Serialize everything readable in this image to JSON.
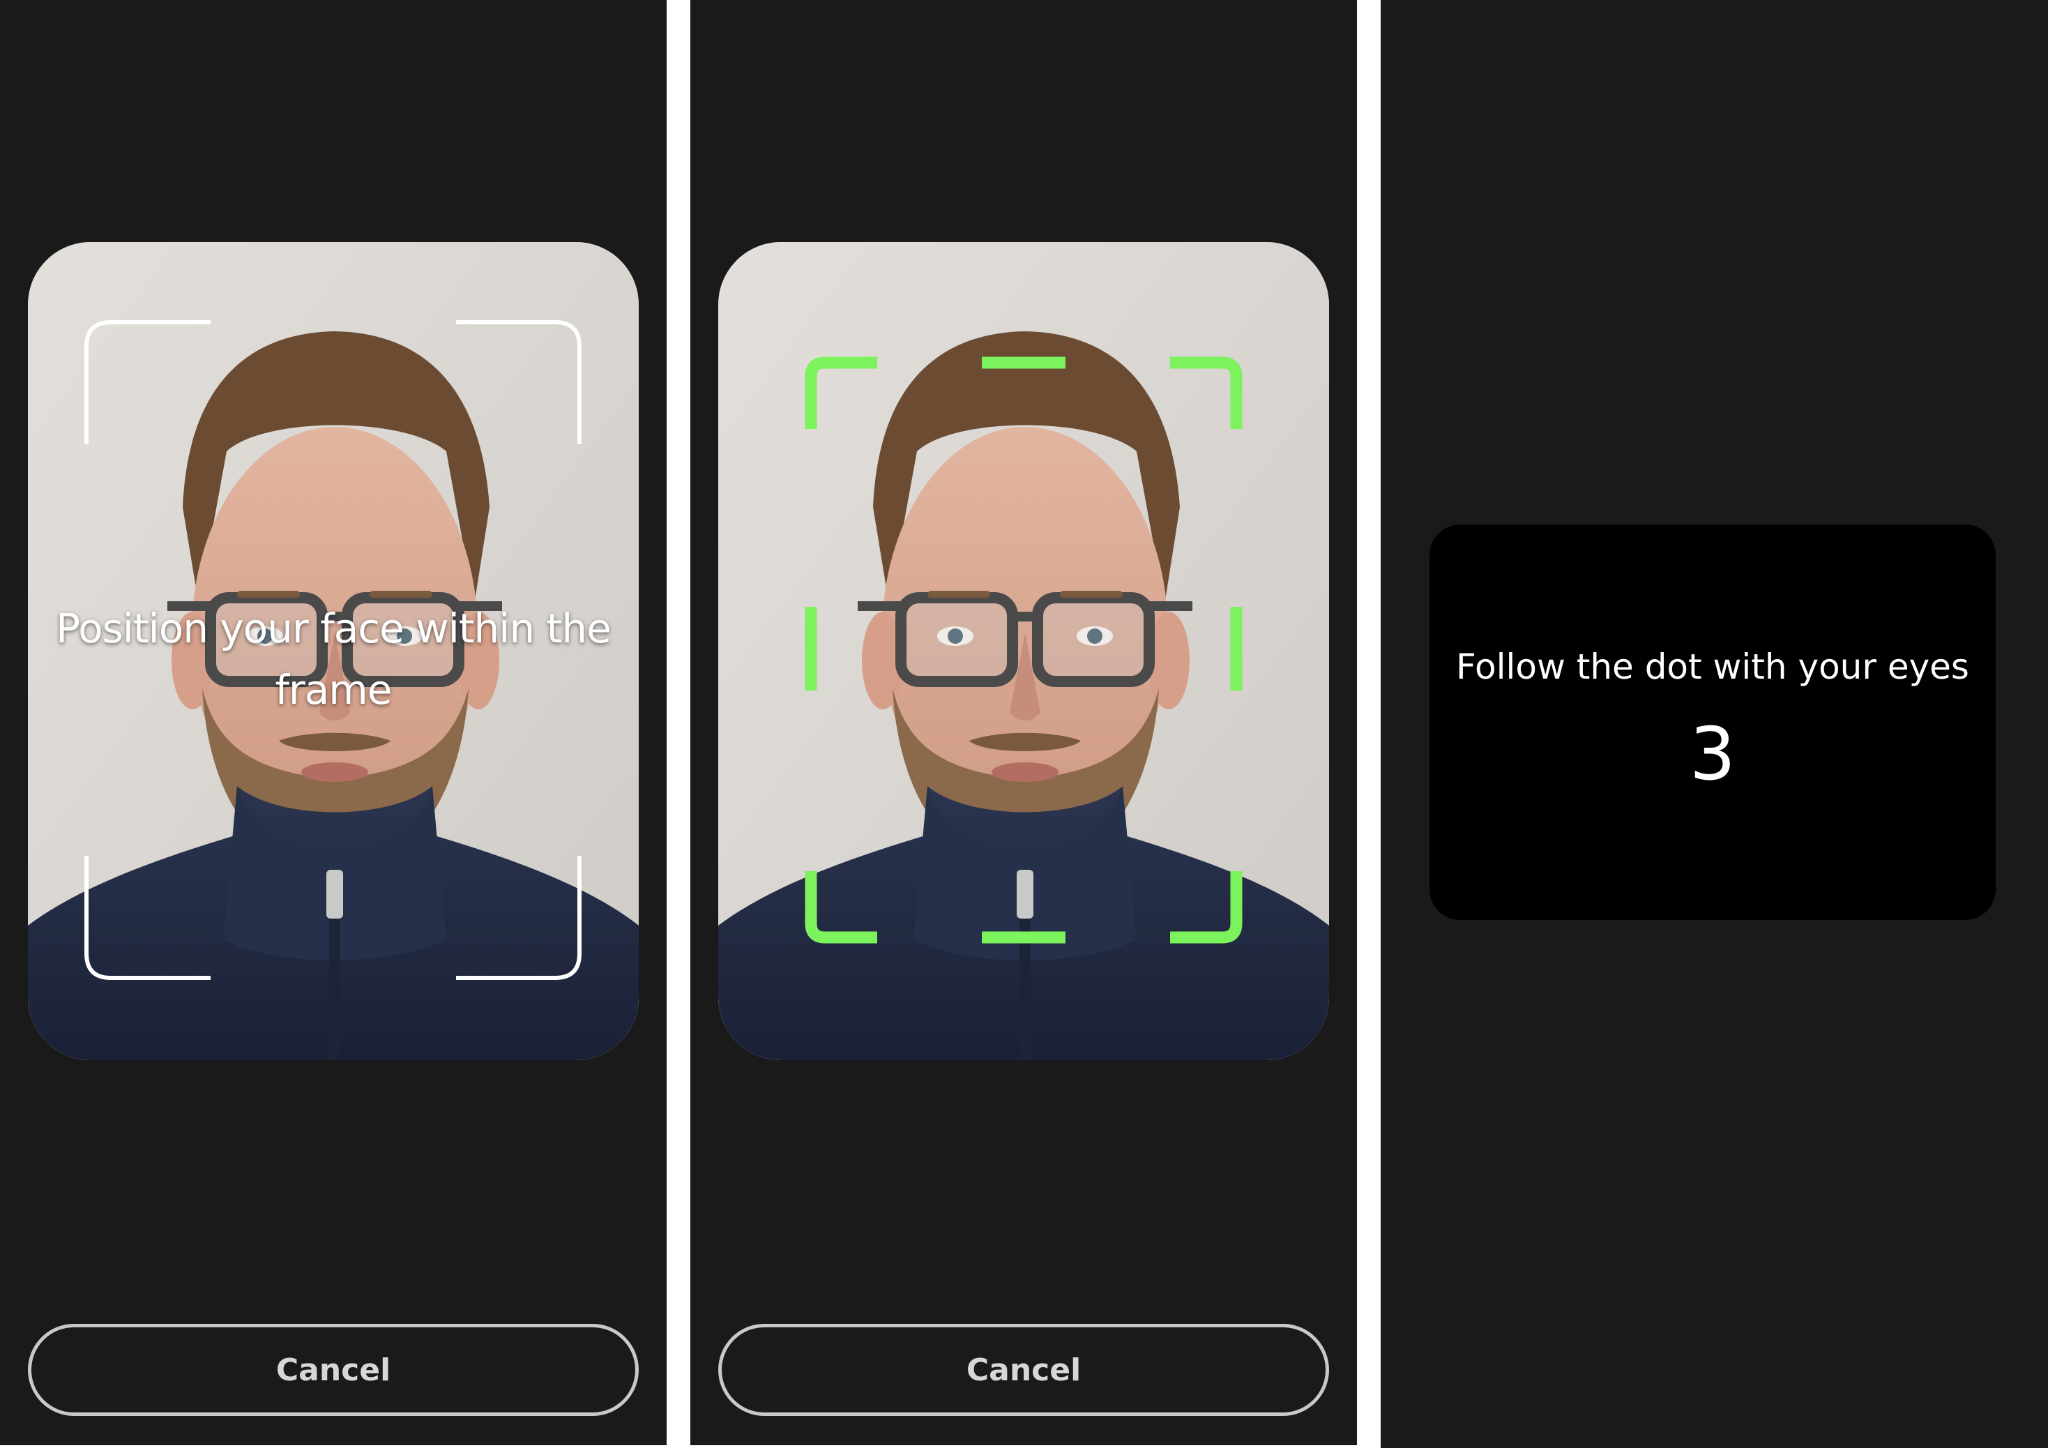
{
  "colors": {
    "screen_background": "#1a1a1a",
    "guide_white": "#ffffff",
    "guide_green": "#7cf25c",
    "cancel_border": "#c9c9c9",
    "card_background": "#000000"
  },
  "screens": [
    {
      "camera": {
        "image": "camera-preview-face",
        "guide_state": "idle",
        "guide_icon": "face-frame-corners-icon"
      },
      "instruction": "Position your face within the frame",
      "cancel_label": "Cancel"
    },
    {
      "camera": {
        "image": "camera-preview-face",
        "guide_state": "face-detected",
        "guide_icon": "face-frame-dashed-icon"
      },
      "cancel_label": "Cancel"
    },
    {
      "card": {
        "instruction": "Follow the dot with your eyes",
        "countdown": "3"
      }
    }
  ]
}
